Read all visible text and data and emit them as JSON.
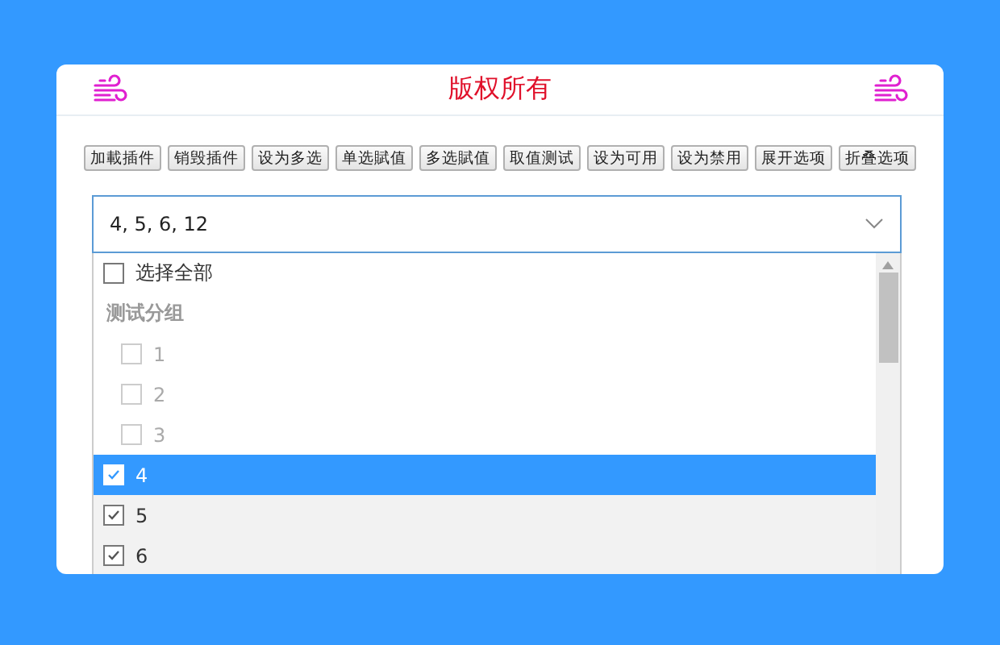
{
  "header": {
    "title": "版权所有"
  },
  "buttons": [
    "加載插件",
    "销毁插件",
    "设为多选",
    "单选賦值",
    "多选賦值",
    "取值测试",
    "设为可用",
    "设为禁用",
    "展开选项",
    "折叠选项"
  ],
  "select": {
    "value": "4, 5, 6, 12",
    "expanded": true
  },
  "dropdown": {
    "select_all": {
      "label": "选择全部",
      "checked": false
    },
    "group": {
      "label": "测试分组",
      "options": [
        {
          "label": "1",
          "checked": false,
          "disabled": true,
          "highlighted": false
        },
        {
          "label": "2",
          "checked": false,
          "disabled": true,
          "highlighted": false
        },
        {
          "label": "3",
          "checked": false,
          "disabled": true,
          "highlighted": false
        }
      ]
    },
    "options": [
      {
        "label": "4",
        "checked": true,
        "disabled": false,
        "highlighted": true
      },
      {
        "label": "5",
        "checked": true,
        "disabled": false,
        "highlighted": false
      },
      {
        "label": "6",
        "checked": true,
        "disabled": false,
        "highlighted": false
      }
    ]
  }
}
